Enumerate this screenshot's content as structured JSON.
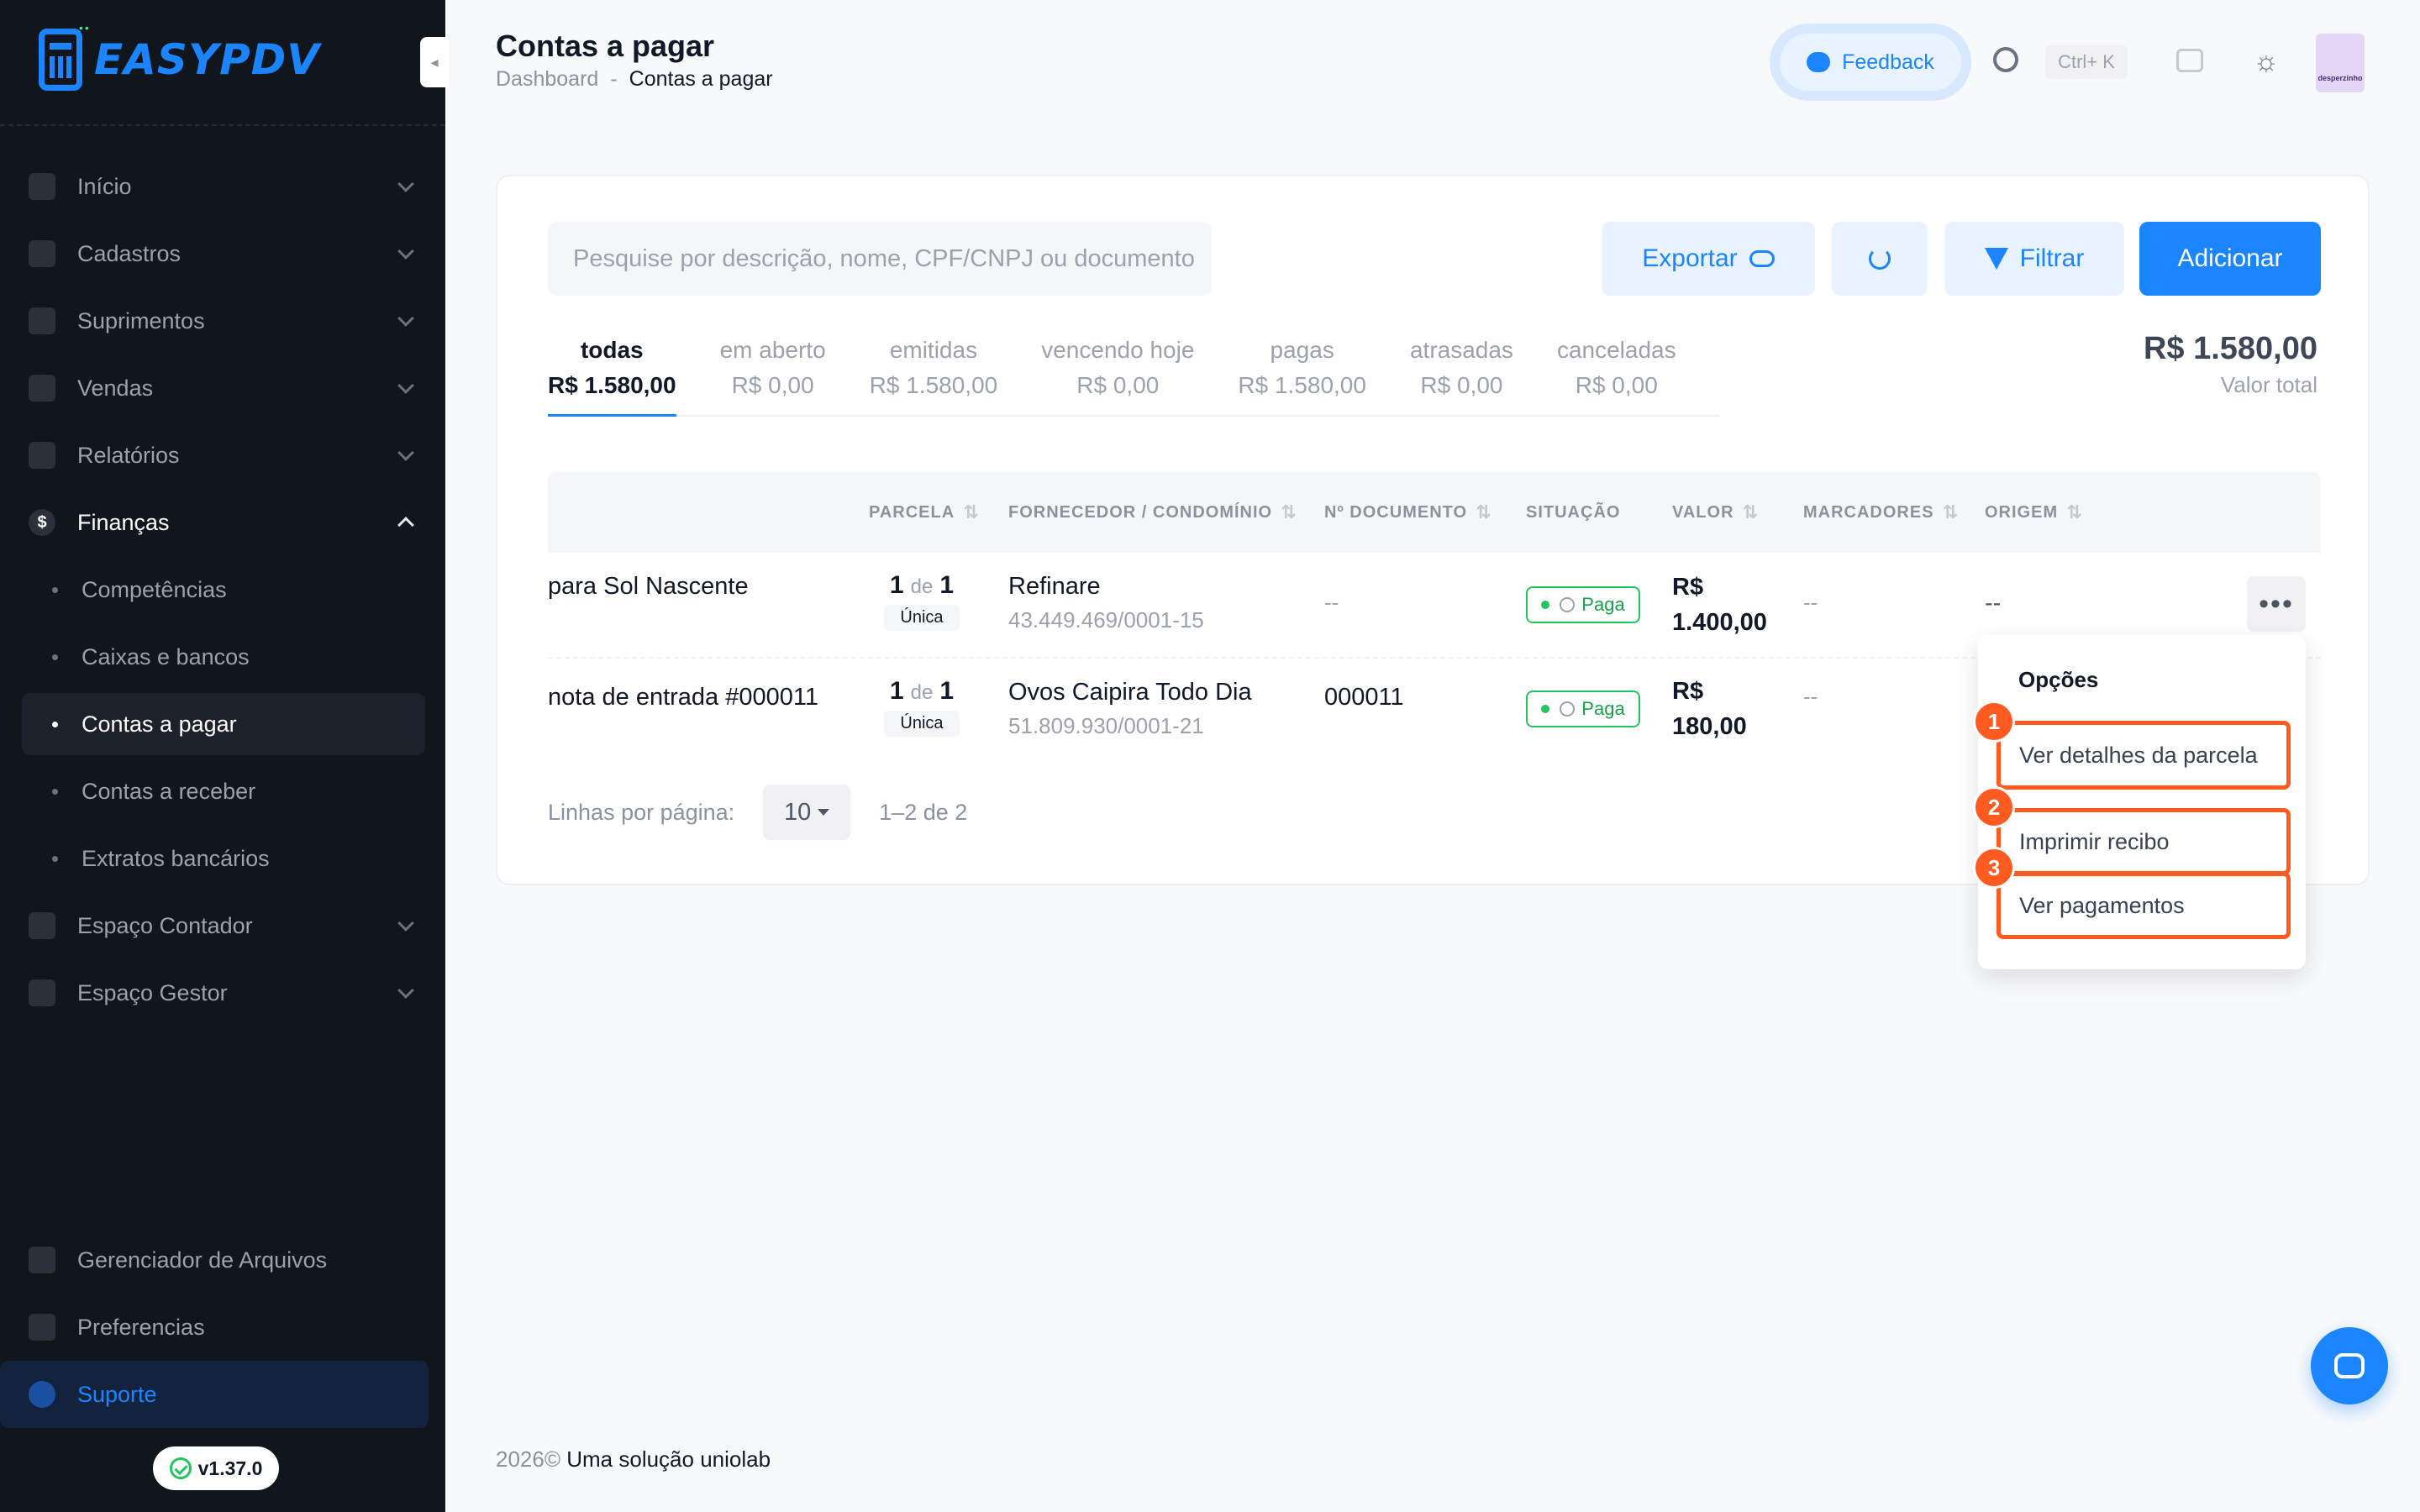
{
  "app": {
    "logo_text": "EASYPDV",
    "version": "v1.37.0"
  },
  "sidebar": {
    "items": [
      {
        "label": "Início",
        "icon": "home-icon"
      },
      {
        "label": "Cadastros",
        "icon": "contacts-icon"
      },
      {
        "label": "Suprimentos",
        "icon": "box-icon"
      },
      {
        "label": "Vendas",
        "icon": "store-icon"
      },
      {
        "label": "Relatórios",
        "icon": "chart-icon"
      },
      {
        "label": "Finanças",
        "icon": "dollar-icon"
      }
    ],
    "finance_sub": [
      {
        "label": "Competências"
      },
      {
        "label": "Caixas e bancos"
      },
      {
        "label": "Contas a pagar"
      },
      {
        "label": "Contas a receber"
      },
      {
        "label": "Extratos bancários"
      }
    ],
    "items_after": [
      {
        "label": "Espaço Contador",
        "icon": "calculator-icon"
      },
      {
        "label": "Espaço Gestor",
        "icon": "people-icon"
      }
    ],
    "bottom": [
      {
        "label": "Gerenciador de Arquivos",
        "icon": "folder-icon"
      },
      {
        "label": "Preferencias",
        "icon": "sliders-icon"
      },
      {
        "label": "Suporte",
        "icon": "help-icon"
      }
    ],
    "finance_icon_glyph": "$"
  },
  "header": {
    "title": "Contas a pagar",
    "breadcrumb": [
      "Dashboard",
      "-",
      "Contas a pagar"
    ],
    "feedback_label": "Feedback",
    "shortcut": "Ctrl+ K",
    "avatar_text": "desperzinho"
  },
  "toolbar": {
    "search_placeholder": "Pesquise por descrição, nome, CPF/CNPJ ou documento",
    "export_label": "Exportar",
    "filter_label": "Filtrar",
    "add_label": "Adicionar"
  },
  "tabs": [
    {
      "label": "todas",
      "value": "R$ 1.580,00"
    },
    {
      "label": "em aberto",
      "value": "R$ 0,00"
    },
    {
      "label": "emitidas",
      "value": "R$ 1.580,00"
    },
    {
      "label": "vencendo hoje",
      "value": "R$ 0,00"
    },
    {
      "label": "pagas",
      "value": "R$ 1.580,00"
    },
    {
      "label": "atrasadas",
      "value": "R$ 0,00"
    },
    {
      "label": "canceladas",
      "value": "R$ 0,00"
    }
  ],
  "total": {
    "value": "R$ 1.580,00",
    "label": "Valor total"
  },
  "table": {
    "columns": [
      "PARCELA",
      "FORNECEDOR / CONDOMÍNIO",
      "Nº DOCUMENTO",
      "SITUAÇÃO",
      "VALOR",
      "MARCADORES",
      "ORIGEM"
    ],
    "rows": [
      {
        "description": "para Sol Nascente",
        "parcela_num": "1",
        "parcela_de": "de",
        "parcela_total": "1",
        "parcela_tipo": "Única",
        "supplier": "Refinare",
        "doc_id": "43.449.469/0001-15",
        "document": "--",
        "status": "Paga",
        "value_line1": "R$",
        "value_line2": "1.400,00",
        "markers": "--",
        "origin": "--"
      },
      {
        "description": "nota de entrada #000011",
        "parcela_num": "1",
        "parcela_de": "de",
        "parcela_total": "1",
        "parcela_tipo": "Única",
        "supplier": "Ovos Caipira Todo Dia",
        "doc_id": "51.809.930/0001-21",
        "document": "000011",
        "status": "Paga",
        "value_line1": "R$",
        "value_line2": "180,00",
        "markers": "--",
        "origin": ""
      }
    ]
  },
  "pagination": {
    "label": "Linhas por página:",
    "per_page": "10",
    "range": "1–2 de 2"
  },
  "dropdown": {
    "title": "Opções",
    "items": [
      {
        "label": "Ver detalhes da parcela",
        "marker": "1"
      },
      {
        "label": "Imprimir recibo",
        "marker": "2"
      },
      {
        "label": "Ver pagamentos",
        "marker": "3"
      }
    ]
  },
  "footer": {
    "year": "2026©",
    "text": "Uma solução uniolab"
  },
  "colors": {
    "accent": "#1b84ff",
    "sidebar_bg": "#11151c",
    "highlight": "#ff5a1f",
    "success": "#22c55e"
  }
}
